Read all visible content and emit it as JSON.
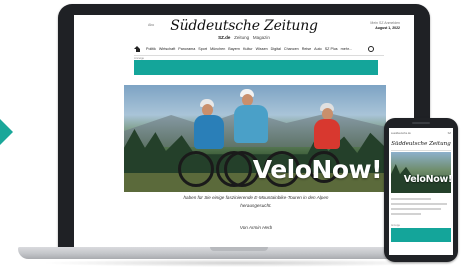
{
  "colors": {
    "accent_teal": "#14a59a",
    "laptop_bezel": "#1f2125"
  },
  "site": {
    "logo": "Süddeutsche Zeitung",
    "left_text": "Abo",
    "sub": {
      "sz_de": "SZ.de",
      "zeitung": "Zeitung",
      "magazin": "Magazin"
    },
    "top_right": "Mein SZ  Anmelden",
    "date": "August 1, 2022",
    "nav_items": [
      "Politik",
      "Wirtschaft",
      "Panorama",
      "Sport",
      "München",
      "Bayern",
      "Kultur",
      "Wissen",
      "Digital",
      "Chancen",
      "Reise",
      "Auto",
      "SZ Plus",
      "mehr..."
    ],
    "ad_label": "Anzeige",
    "hero_title": "VeloNow!",
    "teaser_lines": [
      "haben für Sie einige faszinierende E-Mountainbike-Touren in den Alpen",
      "herausgesucht."
    ],
    "byline": "Von Armin Herb"
  },
  "icons": {
    "home": "home-icon",
    "search": "search-icon"
  },
  "phone": {
    "status_left": "sueddeutsche.de",
    "status_right": "SZ",
    "logo": "Süddeutsche Zeitung",
    "hero_title": "VeloNow!",
    "ad_label": "Anzeige"
  }
}
